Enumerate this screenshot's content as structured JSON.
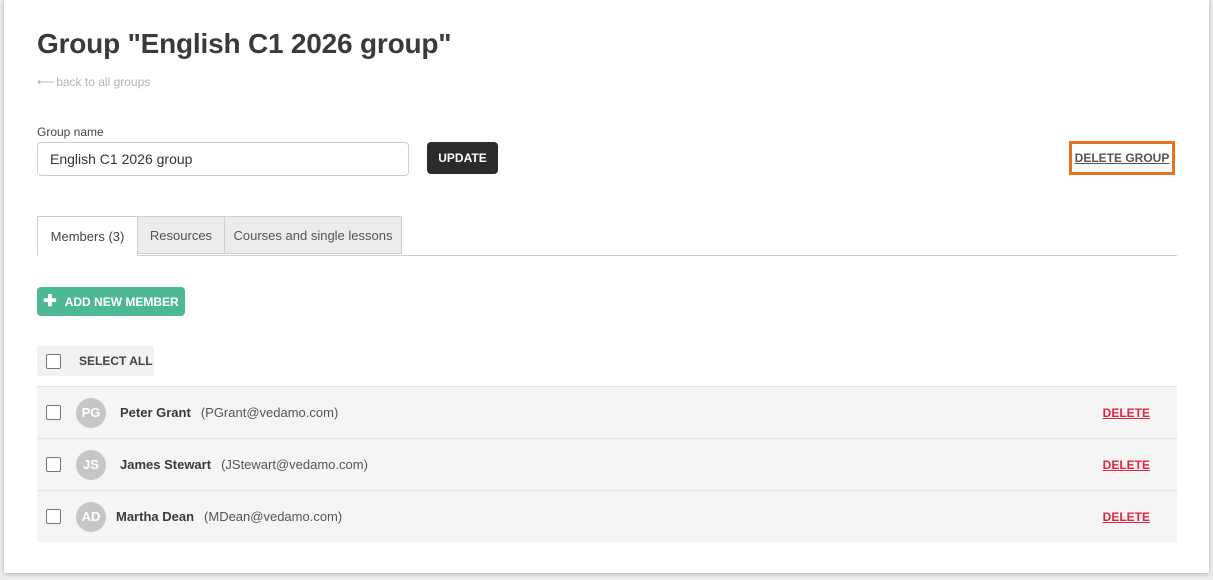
{
  "page": {
    "title": "Group \"English C1 2026 group\"",
    "back_link": "back to all groups",
    "back_arrow_icon": "arrow-left-icon"
  },
  "form": {
    "group_name_label": "Group name",
    "group_name_value": "English C1 2026 group",
    "update_label": "UPDATE",
    "delete_group_label": "DELETE GROUP",
    "highlight_color": "#e8731f"
  },
  "tabs": [
    {
      "label": "Members (3)",
      "active": true
    },
    {
      "label": "Resources",
      "active": false
    },
    {
      "label": "Courses and single lessons",
      "active": false
    }
  ],
  "members_panel": {
    "add_member_label": "ADD NEW MEMBER",
    "add_icon": "plus-icon",
    "select_all_label": "SELECT ALL",
    "delete_label": "DELETE",
    "accent_color": "#4cb896",
    "delete_color": "#e0253f"
  },
  "members": [
    {
      "initials": "PG",
      "name": "Peter Grant",
      "email": "(PGrant@vedamo.com)"
    },
    {
      "initials": "JS",
      "name": "James Stewart",
      "email": "(JStewart@vedamo.com)"
    },
    {
      "initials": "AD",
      "name": "Martha Dean",
      "email": "(MDean@vedamo.com)"
    }
  ]
}
